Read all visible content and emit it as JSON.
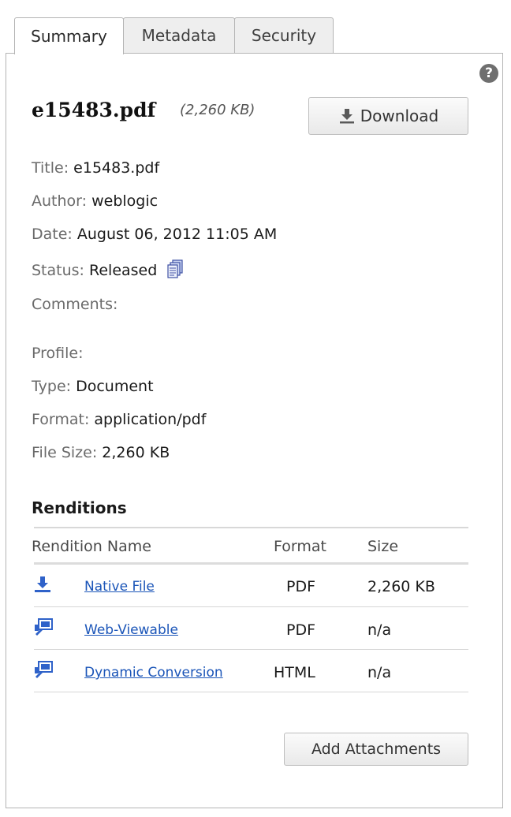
{
  "tabs": [
    {
      "label": "Summary",
      "active": true
    },
    {
      "label": "Metadata",
      "active": false
    },
    {
      "label": "Security",
      "active": false
    }
  ],
  "help_icon": "question-mark-icon",
  "file": {
    "name": "e15483.pdf",
    "size": "(2,260 KB)"
  },
  "download_label": "Download",
  "metadata": {
    "title_label": "Title:",
    "title_value": "e15483.pdf",
    "author_label": "Author:",
    "author_value": "weblogic",
    "date_label": "Date:",
    "date_value": "August 06, 2012 11:05 AM",
    "status_label": "Status:",
    "status_value": "Released",
    "comments_label": "Comments:",
    "comments_value": "",
    "profile_label": "Profile:",
    "profile_value": "",
    "type_label": "Type:",
    "type_value": "Document",
    "format_label": "Format:",
    "format_value": "application/pdf",
    "filesize_label": "File Size:",
    "filesize_value": "2,260 KB"
  },
  "renditions": {
    "title": "Renditions",
    "columns": [
      "Rendition Name",
      "Format",
      "Size"
    ],
    "rows": [
      {
        "icon": "download-icon",
        "name": "Native File",
        "format": "PDF",
        "size": "2,260 KB"
      },
      {
        "icon": "web-view-icon",
        "name": "Web-Viewable",
        "format": "PDF",
        "size": "n/a"
      },
      {
        "icon": "web-view-icon",
        "name": "Dynamic Conversion",
        "format": "HTML",
        "size": "n/a"
      }
    ]
  },
  "add_attachments_label": "Add Attachments",
  "colors": {
    "link": "#1b55b8",
    "icon_blue": "#2f62c9",
    "border": "#b4b4b4"
  }
}
